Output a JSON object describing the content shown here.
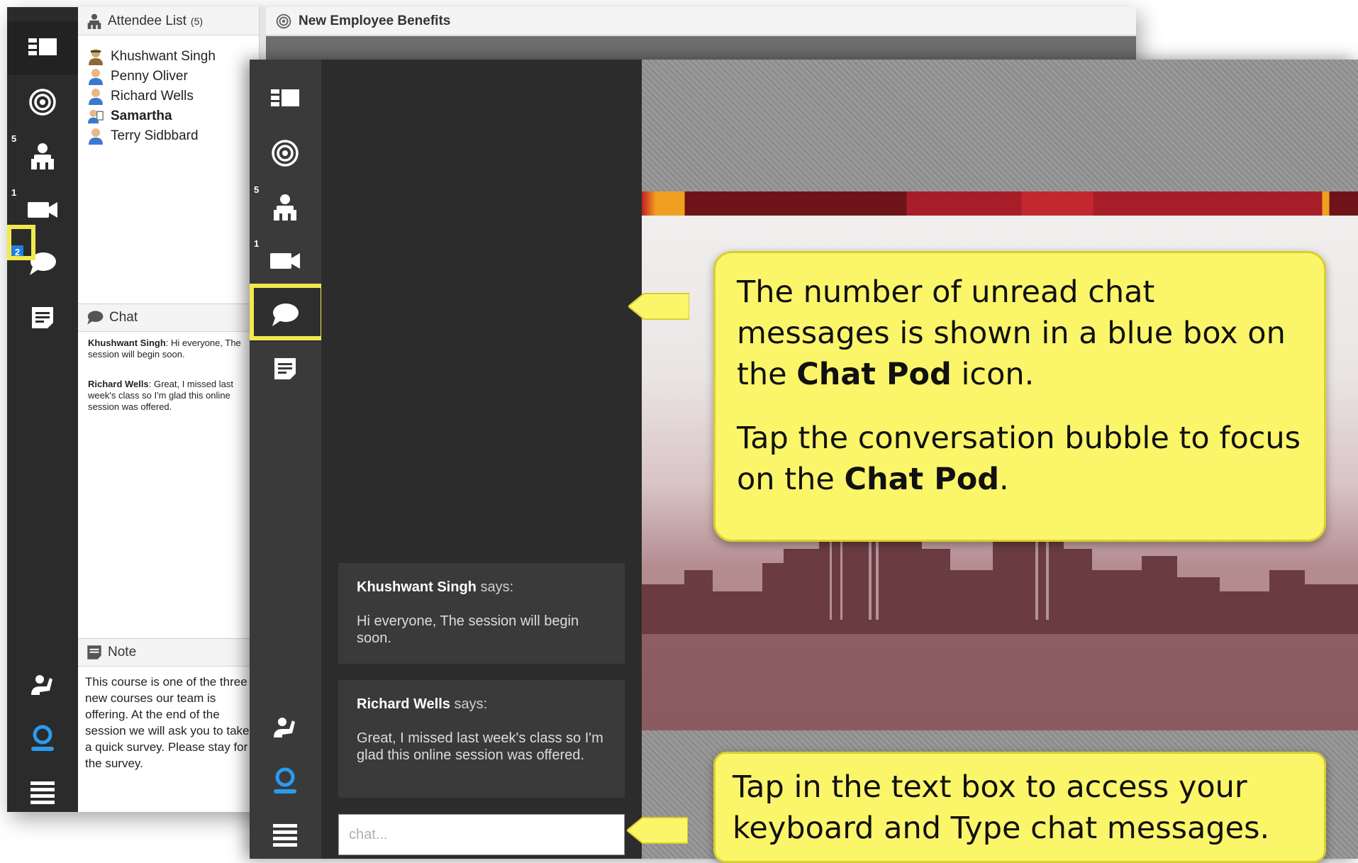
{
  "back_window": {
    "title": "New Employee Benefits",
    "rail": {
      "attendee_count": "5",
      "camera_count": "1",
      "unread_chat_count": "2"
    },
    "attendee_pod": {
      "title": "Attendee List",
      "count": "(5)",
      "attendees": [
        {
          "name": "Khushwant Singh",
          "role": "host"
        },
        {
          "name": "Penny Oliver",
          "role": "participant"
        },
        {
          "name": "Richard Wells",
          "role": "participant"
        },
        {
          "name": "Samartha",
          "role": "presenter"
        },
        {
          "name": "Terry Sidbbard",
          "role": "participant"
        }
      ]
    },
    "chat_pod": {
      "title": "Chat",
      "messages": [
        {
          "sender": "Khushwant Singh",
          "text": "Hi everyone, The session will begin soon."
        },
        {
          "sender": "Richard Wells",
          "text": "Great, I missed last week's class so I'm glad this online session was offered."
        }
      ]
    },
    "note_pod": {
      "title": "Note",
      "text": "This course is one of the three new courses our team is offering. At the end of the session we will ask you to take a quick survey. Please stay for the survey."
    }
  },
  "front_window": {
    "rail": {
      "attendee_count": "5",
      "camera_count": "1"
    },
    "chat": {
      "says_label": "says:",
      "messages": [
        {
          "sender": "Khushwant Singh",
          "text": "Hi everyone, The session will begin soon."
        },
        {
          "sender": "Richard Wells",
          "text": "Great, I missed last week's class so I'm glad this online session was offered."
        }
      ],
      "input_placeholder": "chat..."
    }
  },
  "callouts": {
    "top": {
      "line1": "The number of unread chat messages is shown in a blue box on the",
      "line1_bold": "Chat Pod",
      "line1_end": "icon.",
      "line2": "Tap the conversation bubble to focus on the",
      "line2_bold": "Chat Pod",
      "line2_end": "."
    },
    "bottom": {
      "text": "Tap in the text box to access your keyboard and Type chat messages."
    }
  },
  "colors": {
    "callout_fill": "#fbf56a",
    "highlight_border": "#f2e94e",
    "unread_badge": "#1e7fe0",
    "rail_dark": "#2b2b2b"
  },
  "icons": {
    "rail": [
      "layout-icon",
      "share-icon",
      "attendee-icon",
      "camera-icon",
      "chat-bubble-icon",
      "note-icon",
      "raise-hand-icon",
      "user-status-icon",
      "menu-icon"
    ]
  }
}
